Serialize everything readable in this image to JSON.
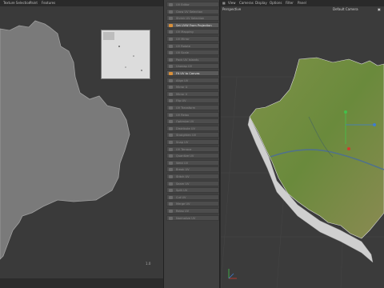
{
  "uv_editor": {
    "menu": [
      "Texture Selection",
      "Paint",
      "Features"
    ],
    "scale_label": "1.0"
  },
  "commands": [
    {
      "label": "UV Editor"
    },
    {
      "label": "Grow UV Selection"
    },
    {
      "label": "Shrink UV Selection"
    },
    {
      "label": "Set UVW From Projection",
      "active": true
    },
    {
      "label": "UV Mapping"
    },
    {
      "label": "UV Mirror"
    },
    {
      "label": "UV Rotate"
    },
    {
      "label": "UV Scale"
    },
    {
      "label": "Pack UV Islands"
    },
    {
      "label": "Unwrap UV"
    },
    {
      "label": "Fit UV to Canvas",
      "active": true
    },
    {
      "label": "Align UV"
    },
    {
      "label": "Mirror U"
    },
    {
      "label": "Mirror V"
    },
    {
      "label": "Flip UV"
    },
    {
      "label": "UV Transform"
    },
    {
      "label": "UV Relax"
    },
    {
      "label": "Optimize UV"
    },
    {
      "label": "Distribute UV"
    },
    {
      "label": "Straighten UV"
    },
    {
      "label": "Snap UV"
    },
    {
      "label": "UV Terrace"
    },
    {
      "label": "Quantize UV"
    },
    {
      "label": "Weld UV"
    },
    {
      "label": "Break UV"
    },
    {
      "label": "Stitch UV"
    },
    {
      "label": "Seam UV"
    },
    {
      "label": "Split UV"
    },
    {
      "label": "Cut UV"
    },
    {
      "label": "Merge UV"
    },
    {
      "label": "Relax UV"
    },
    {
      "label": "Normalize UV"
    }
  ],
  "viewport": {
    "menu": [
      "View",
      "Cameras",
      "Display",
      "Options",
      "Filter",
      "Panel"
    ],
    "view_name": "Perspective",
    "camera_name": "Default Camera"
  },
  "colors": {
    "accent": "#d9903a",
    "uv_fill": "#7a7a7a",
    "terrain_green": "#6f8f3f"
  }
}
